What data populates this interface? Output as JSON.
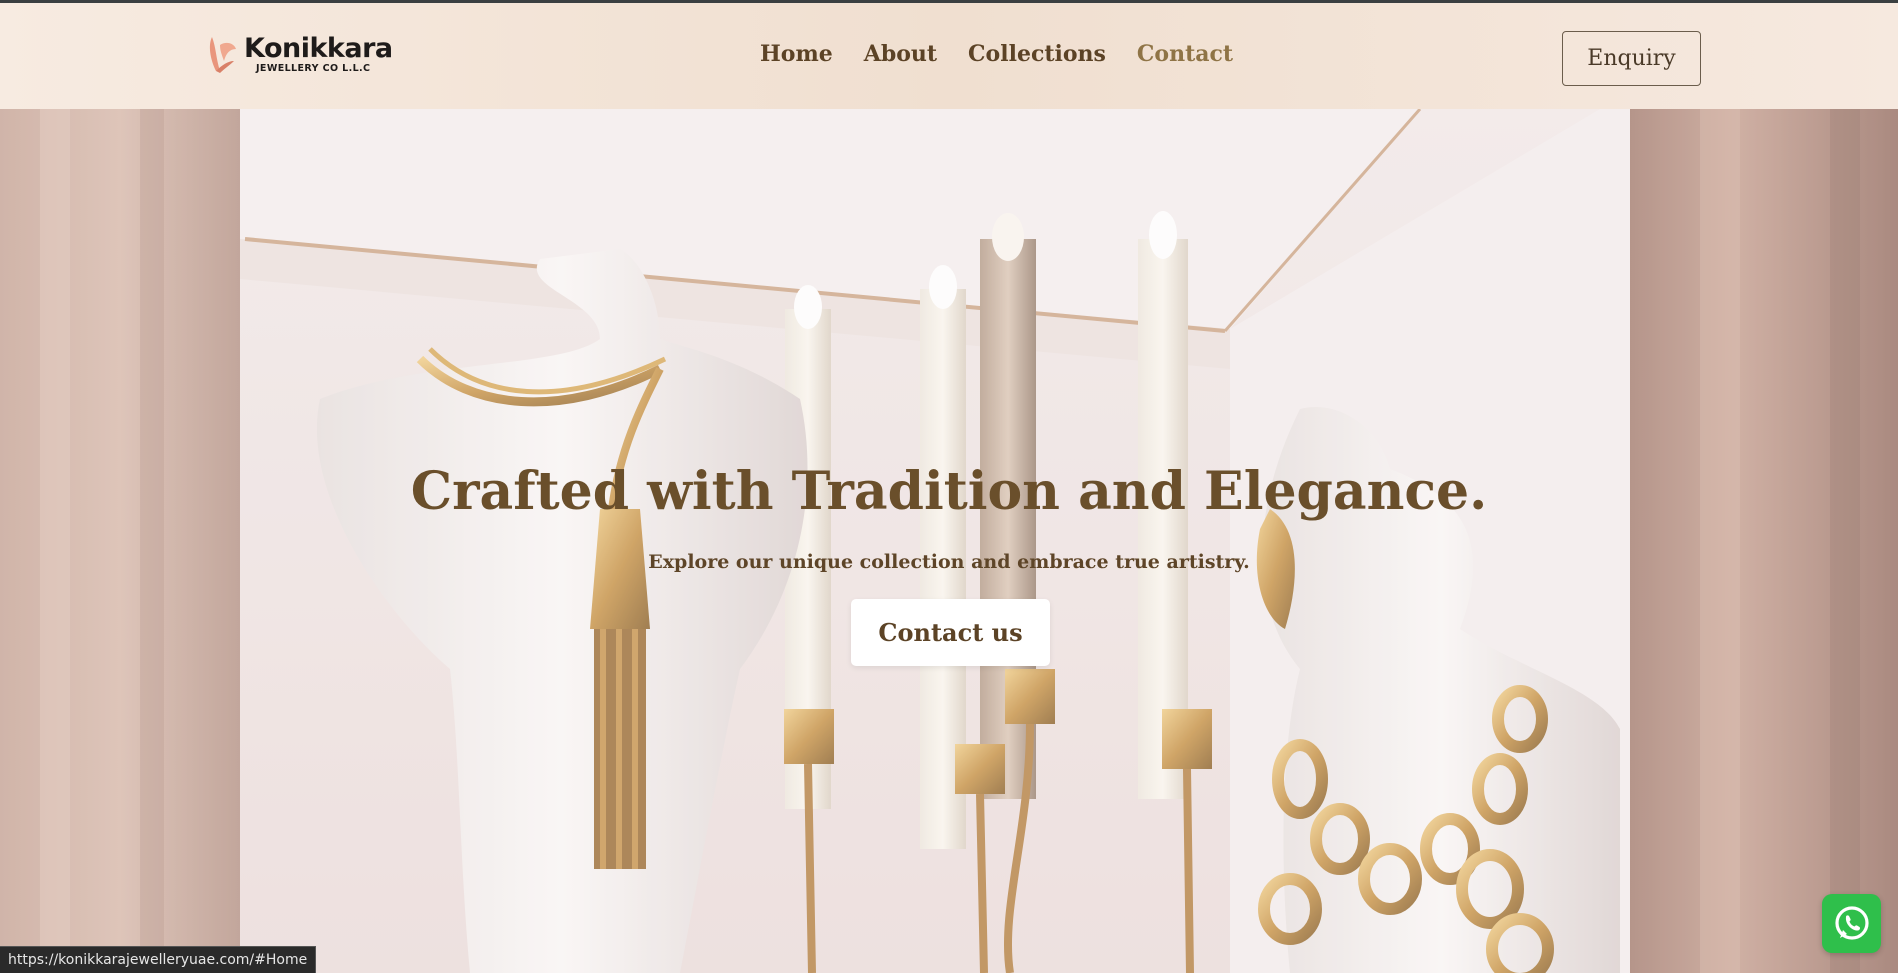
{
  "brand": {
    "name": "Konikkara",
    "subtitle": "JEWELLERY CO L.L.C",
    "accent_color": "#e9957c"
  },
  "nav": {
    "items": [
      {
        "label": "Home",
        "active": false
      },
      {
        "label": "About",
        "active": false
      },
      {
        "label": "Collections",
        "active": false
      },
      {
        "label": "Contact",
        "active": true
      }
    ]
  },
  "header": {
    "enquiry_label": "Enquiry"
  },
  "hero": {
    "title": "Crafted with Tradition and Elegance.",
    "subtitle": "Explore our unique collection and embrace true artistry.",
    "cta_label": "Contact us"
  },
  "floating": {
    "whatsapp_icon": "whatsapp-icon",
    "color": "#2fbf4b"
  },
  "status_bar": {
    "url": "https://konikkarajewelleryuae.com/#Home"
  }
}
